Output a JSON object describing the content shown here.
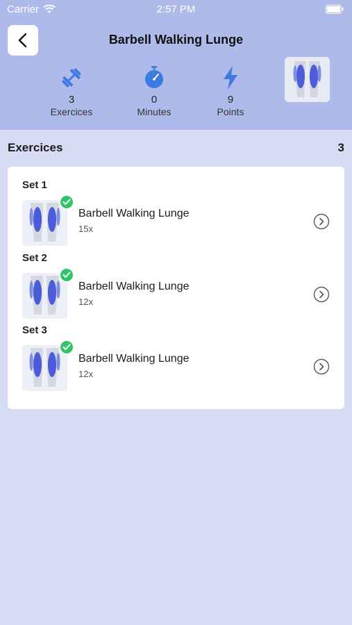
{
  "status_bar": {
    "carrier": "Carrier",
    "time": "2:57 PM"
  },
  "header": {
    "title": "Barbell Walking Lunge",
    "stats": [
      {
        "icon": "dumbbell-icon",
        "value": "3",
        "label": "Exercices"
      },
      {
        "icon": "stopwatch-icon",
        "value": "0",
        "label": "Minutes"
      },
      {
        "icon": "lightning-icon",
        "value": "9",
        "label": "Points"
      }
    ]
  },
  "exercises_section": {
    "title": "Exercices",
    "count": "3"
  },
  "sets": [
    {
      "label": "Set 1",
      "name": "Barbell Walking Lunge",
      "reps": "15x",
      "completed": true
    },
    {
      "label": "Set 2",
      "name": "Barbell Walking Lunge",
      "reps": "12x",
      "completed": true
    },
    {
      "label": "Set 3",
      "name": "Barbell Walking Lunge",
      "reps": "12x",
      "completed": true
    }
  ],
  "colors": {
    "header_bg": "#aebae9",
    "page_bg": "#d6dcf2",
    "accent_blue": "#3e7be0",
    "check_green": "#33c46a"
  }
}
